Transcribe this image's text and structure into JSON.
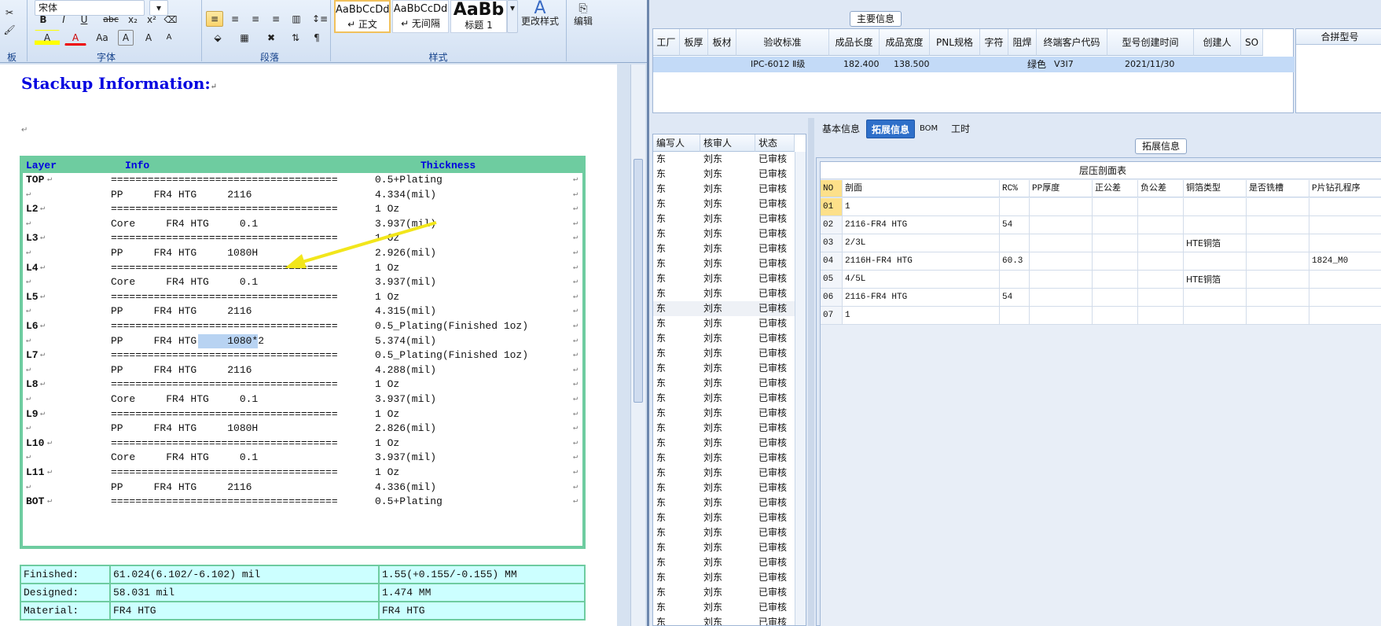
{
  "ribbon": {
    "font_name": "宋体",
    "clipboard_label": "板",
    "font_group_label": "字体",
    "paragraph_group_label": "段落",
    "styles_group_label": "样式",
    "styles": [
      {
        "preview": "AaBbCcDd",
        "name": "↵ 正文"
      },
      {
        "preview": "AaBbCcDd",
        "name": "↵ 无间隔"
      },
      {
        "preview": "AaBb",
        "name": "标题 1"
      }
    ],
    "change_styles": "更改样式",
    "edit": "编辑",
    "fmt_buttons": [
      "B",
      "I",
      "U",
      "abc",
      "x₂",
      "x²",
      "A",
      "A",
      "Aa",
      "A",
      "A",
      "A"
    ]
  },
  "doc": {
    "title": "Stackup Information:",
    "mark": "↵",
    "headers": {
      "layer": "Layer",
      "info": "Info",
      "thickness": "Thickness"
    },
    "line": "=====================================",
    "rows": [
      {
        "layer": "TOP",
        "info": "LINE",
        "thk": "0.5+Plating"
      },
      {
        "layer": "",
        "info": "PP     FR4 HTG     2116",
        "thk": "4.334(mil)"
      },
      {
        "layer": "L2",
        "info": "LINE",
        "thk": "1 Oz"
      },
      {
        "layer": "",
        "info": "Core     FR4 HTG     0.1",
        "thk": "3.937(mil)"
      },
      {
        "layer": "L3",
        "info": "LINE",
        "thk": "1 Oz"
      },
      {
        "layer": "",
        "info": "PP     FR4 HTG     1080H",
        "thk": "2.926(mil)"
      },
      {
        "layer": "L4",
        "info": "LINE",
        "thk": "1 Oz"
      },
      {
        "layer": "",
        "info": "Core     FR4 HTG     0.1",
        "thk": "3.937(mil)"
      },
      {
        "layer": "L5",
        "info": "LINE",
        "thk": "1 Oz"
      },
      {
        "layer": "",
        "info": "PP     FR4 HTG     2116",
        "thk": "4.315(mil)"
      },
      {
        "layer": "L6",
        "info": "LINE",
        "thk": "0.5_Plating(Finished 1oz)"
      },
      {
        "layer": "",
        "info": "PP     FR4 HTG     1080*2",
        "thk": "5.374(mil)"
      },
      {
        "layer": "L7",
        "info": "LINE",
        "thk": "0.5_Plating(Finished 1oz)"
      },
      {
        "layer": "",
        "info": "PP     FR4 HTG     2116",
        "thk": "4.288(mil)"
      },
      {
        "layer": "L8",
        "info": "LINE",
        "thk": "1 Oz"
      },
      {
        "layer": "",
        "info": "Core     FR4 HTG     0.1",
        "thk": "3.937(mil)"
      },
      {
        "layer": "L9",
        "info": "LINE",
        "thk": "1 Oz"
      },
      {
        "layer": "",
        "info": "PP     FR4 HTG     1080H",
        "thk": "2.826(mil)"
      },
      {
        "layer": "L10",
        "info": "LINE",
        "thk": "1 Oz"
      },
      {
        "layer": "",
        "info": "Core     FR4 HTG     0.1",
        "thk": "3.937(mil)"
      },
      {
        "layer": "L11",
        "info": "LINE",
        "thk": "1 Oz"
      },
      {
        "layer": "",
        "info": "PP     FR4 HTG     2116",
        "thk": "4.336(mil)"
      },
      {
        "layer": "BOT",
        "info": "LINE",
        "thk": "0.5+Plating"
      }
    ],
    "summary": [
      {
        "label": "Finished:",
        "mil": "61.024(6.102/-6.102) mil",
        "mm": "1.55(+0.155/-0.155) MM"
      },
      {
        "label": "Designed:",
        "mil": "58.031 mil",
        "mm": "1.474 MM"
      },
      {
        "label": "Material:",
        "mil": "FR4 HTG",
        "mm": "FR4 HTG"
      }
    ]
  },
  "app": {
    "main_group_title": "主要信息",
    "main_headers": [
      "工厂",
      "板厚",
      "板材",
      "验收标准",
      "成品长度",
      "成品宽度",
      "PNL规格",
      "字符",
      "阻焊",
      "终端客户代码",
      "型号创建时间",
      "创建人",
      "SO"
    ],
    "main_row": {
      "standard": "IPC-6012 Ⅱ级",
      "length": "182.400",
      "width": "138.500",
      "solder": "绿色",
      "customer": "V3I7",
      "created": "2021/11/30"
    },
    "merge_header": "合拼型号",
    "left_headers": [
      "编写人",
      "核审人",
      "状态"
    ],
    "left_row": {
      "writer": "东",
      "reviewer": "刘东",
      "status": "已审核"
    },
    "tabs": [
      "基本信息",
      "拓展信息",
      "BOM",
      "工时"
    ],
    "ext_group_title": "拓展信息",
    "lam_title": "层压剖面表",
    "lam_headers": [
      "NO",
      "剖面",
      "RC%",
      "PP厚度",
      "正公差",
      "负公差",
      "铜箔类型",
      "是否铣槽",
      "P片钻孔程序"
    ],
    "lam_rows": [
      [
        "01",
        "1",
        "",
        "",
        "",
        "",
        "",
        "",
        ""
      ],
      [
        "02",
        "2116-FR4 HTG",
        "54",
        "",
        "",
        "",
        "",
        "",
        ""
      ],
      [
        "03",
        "2/3L",
        "",
        "",
        "",
        "",
        "HTE铜箔",
        "",
        ""
      ],
      [
        "04",
        "2116H-FR4 HTG",
        "60.3",
        "",
        "",
        "",
        "",
        "",
        "1824_M0"
      ],
      [
        "05",
        "4/5L",
        "",
        "",
        "",
        "",
        "HTE铜箔",
        "",
        ""
      ],
      [
        "06",
        "2116-FR4 HTG",
        "54",
        "",
        "",
        "",
        "",
        "",
        ""
      ],
      [
        "07",
        "1",
        "",
        "",
        "",
        "",
        "",
        "",
        ""
      ]
    ]
  },
  "colors": {
    "accent": "#2e6fc9",
    "table_border": "#6ecca0",
    "summary_bg": "#ccffff",
    "arrow": "#f2e61b",
    "selection": "#c3daf7"
  }
}
